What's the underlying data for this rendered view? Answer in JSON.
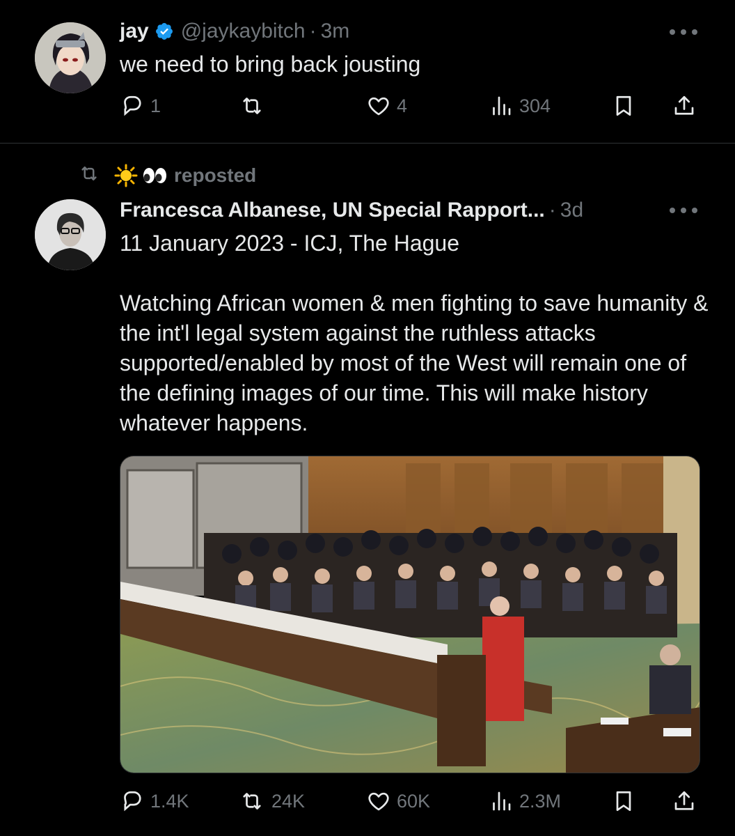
{
  "tweets": [
    {
      "display_name": "jay",
      "handle": "@jaykaybitch",
      "separator": "·",
      "time": "3m",
      "text": "we need to bring back jousting",
      "stats": {
        "replies": "1",
        "reposts": "",
        "likes": "4",
        "views": "304"
      }
    },
    {
      "repost_label": "reposted",
      "repost_user_emoji": "☀️👀",
      "display_name": "Francesca Albanese, UN Special Rapport...",
      "separator": "·",
      "time": "3d",
      "text_lines": [
        "11 January 2023 - ICJ, The Hague",
        "Watching African women & men fighting to save humanity & the int'l legal system against the ruthless attacks supported/enabled by most of the West will remain one of the defining images of our time. This will make history whatever happens."
      ],
      "media_alt": "courtroom photo",
      "stats": {
        "replies": "1.4K",
        "reposts": "24K",
        "likes": "60K",
        "views": "2.3M"
      }
    }
  ],
  "icons": {
    "verified": "verified-badge-icon",
    "more": "more-icon",
    "reply": "reply-icon",
    "repost": "repost-icon",
    "like": "heart-icon",
    "views": "views-icon",
    "bookmark": "bookmark-icon",
    "share": "share-icon"
  },
  "colors": {
    "background": "#000000",
    "text": "#e7e9ea",
    "muted": "#71767b",
    "verified": "#1d9bf0",
    "divider": "#2f3336"
  }
}
